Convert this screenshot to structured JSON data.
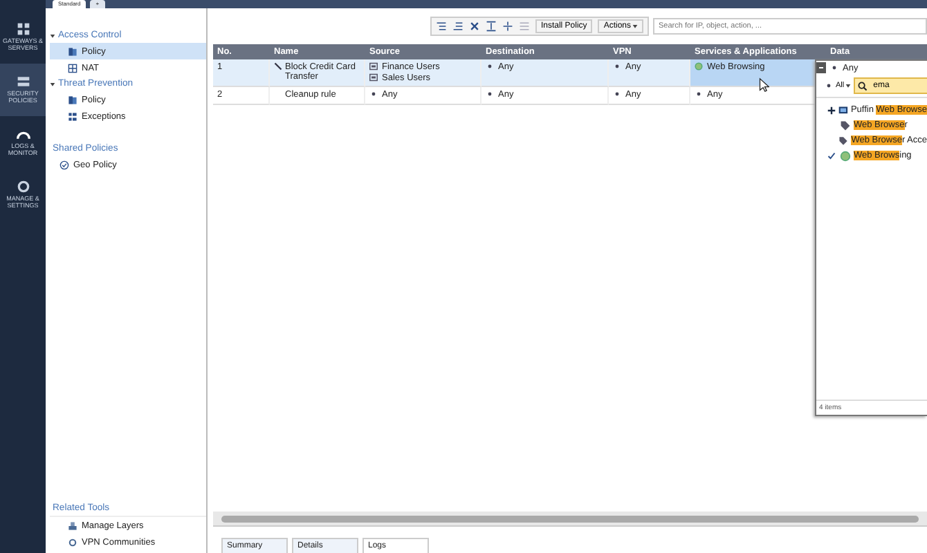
{
  "nav": [
    {
      "label": "GATEWAYS & SERVERS",
      "selected": false
    },
    {
      "label": "SECURITY POLICIES",
      "selected": true
    },
    {
      "label": "LOGS & MONITOR",
      "selected": false
    },
    {
      "label": "MANAGE & SETTINGS",
      "selected": false
    }
  ],
  "top_tabs": [
    {
      "label": "Standard",
      "selected": true
    },
    {
      "label": "+",
      "selected": false
    }
  ],
  "tree": [
    {
      "label": "Access Control",
      "expanded": true,
      "children": [
        {
          "label": "Policy",
          "selected": true
        },
        {
          "label": "NAT",
          "selected": false
        }
      ]
    },
    {
      "label": "Threat Prevention",
      "expanded": true,
      "children": [
        {
          "label": "Policy",
          "selected": false
        },
        {
          "label": "Exceptions",
          "selected": false
        }
      ]
    }
  ],
  "shared_policies": {
    "heading": "Shared Policies",
    "items": [
      {
        "label": "Geo Policy"
      }
    ]
  },
  "related_tools": {
    "heading": "Related Tools",
    "items": [
      {
        "label": "Manage Layers"
      },
      {
        "label": "VPN Communities"
      }
    ]
  },
  "toolbar": {
    "install": "Install Policy",
    "actions": "Actions",
    "search_placeholder": "Search for IP, object, action, ..."
  },
  "table": {
    "columns": [
      "No.",
      "Name",
      "Source",
      "Destination",
      "VPN",
      "Services & Applications",
      "Data"
    ],
    "rows": [
      {
        "no": "1",
        "name": "Block Credit Card Transfer",
        "edited": true,
        "selected": true,
        "source": [
          {
            "label": "Finance Users",
            "kind": "group"
          },
          {
            "label": "Sales Users",
            "kind": "group"
          }
        ],
        "destination": "Any",
        "vpn": "Any",
        "services": {
          "label": "Web Browsing",
          "kind": "app"
        }
      },
      {
        "no": "2",
        "name": "Cleanup rule",
        "edited": false,
        "selected": false,
        "source": [
          {
            "label": "Any",
            "kind": "any"
          }
        ],
        "destination": "Any",
        "vpn": "Any",
        "services": {
          "label": "Any",
          "kind": "any"
        }
      }
    ]
  },
  "picker": {
    "current": "Any",
    "filter": "All",
    "search": "ema",
    "items": [
      {
        "prefix": "Puffin ",
        "match": "Web Browse",
        "checked": false
      },
      {
        "match": "Web Browse",
        "rest": "r",
        "checked": false
      },
      {
        "match": "Web Browse",
        "rest": "r Acce",
        "checked": false
      },
      {
        "match": "Web Brows",
        "rest": "ing",
        "checked": true
      }
    ],
    "footer": "4 items"
  },
  "bottom_tabs": [
    {
      "label": "Summary",
      "selected": false
    },
    {
      "label": "Details",
      "selected": false
    },
    {
      "label": "Logs",
      "selected": true
    }
  ]
}
